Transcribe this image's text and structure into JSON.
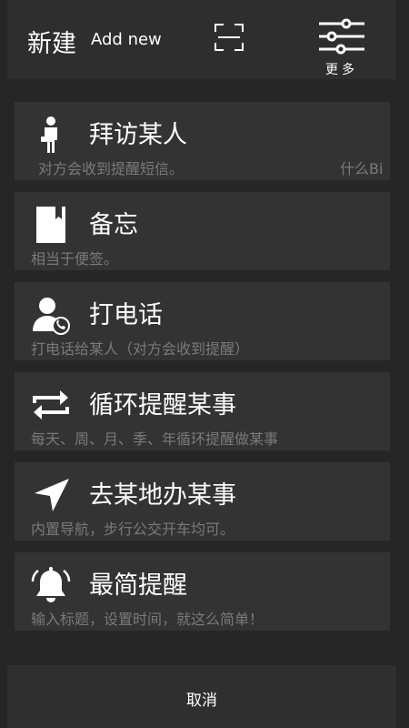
{
  "header": {
    "title": "新建",
    "subtitle": "Add new",
    "scan_icon": "scan-icon",
    "more_icon": "sliders-icon",
    "more_label": "更多"
  },
  "options": [
    {
      "icon": "visitor-icon",
      "label": "拜访某人",
      "desc": "对方会收到提醒短信。",
      "extra": "什么Bi"
    },
    {
      "icon": "notebook-icon",
      "label": "备忘",
      "desc": "相当于便签。"
    },
    {
      "icon": "call-contact-icon",
      "label": "打电话",
      "desc": "打电话给某人（对方会收到提醒）"
    },
    {
      "icon": "repeat-icon",
      "label": "循环提醒某事",
      "desc": "每天、周、月、季、年循环提醒做某事"
    },
    {
      "icon": "navigation-icon",
      "label": "去某地办某事",
      "desc": "内置导航，步行公交开车均可。"
    },
    {
      "icon": "bell-icon",
      "label": "最简提醒",
      "desc": "输入标题，设置时间，就这么简单！"
    }
  ],
  "footer": {
    "cancel_label": "取消"
  },
  "colors": {
    "background": "#262626",
    "card": "#333333",
    "desc_text": "#7a7a7a"
  }
}
